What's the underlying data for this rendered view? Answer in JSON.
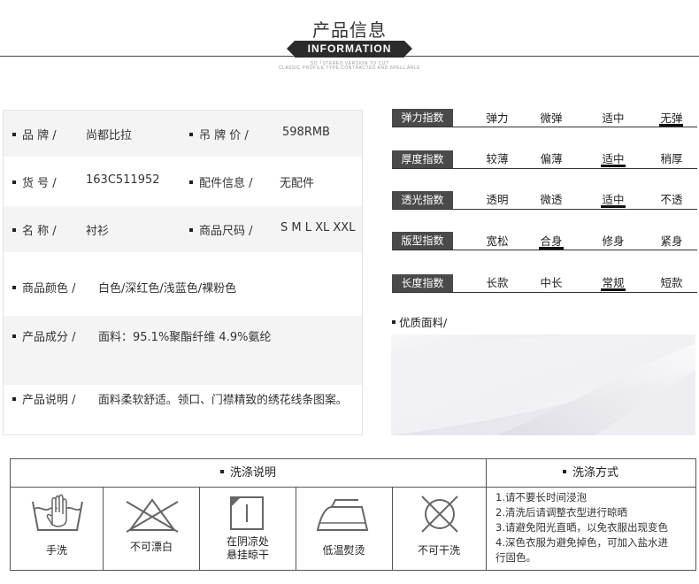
{
  "header": {
    "title_cn": "产品信息",
    "title_en": "INFORMATION",
    "tagline_1": "SO「STEREO VERSION TO CUT",
    "tagline_2": "CLASSIC PROFILE TYPE CONTRACTED AND SPELL ARLE"
  },
  "product": {
    "brand_label": "品  牌 /",
    "brand_value": "尚都比拉",
    "price_label": "吊 牌 价 /",
    "price_value": "598RMB",
    "sku_label": "货  号 /",
    "sku_value": "163C511952",
    "accessory_label": "配件信息 /",
    "accessory_value": "无配件",
    "name_label": "名  称 /",
    "name_value": "衬衫",
    "size_label": "商品尺码 /",
    "size_value": "S M L XL XXL",
    "color_label": "商品颜色 /",
    "color_value": "白色/深红色/浅蓝色/裸粉色",
    "material_label": "产品成分 /",
    "material_value": "面料：95.1%聚酯纤维 4.9%氨纶",
    "desc_label": "产品说明 /",
    "desc_value": "面料柔软舒适。领口、门襟精致的绣花线条图案。"
  },
  "indices": [
    {
      "label": "弹力指数",
      "options": [
        "弹力",
        "微弹",
        "适中",
        "无弹"
      ],
      "selected": 3
    },
    {
      "label": "厚度指数",
      "options": [
        "较薄",
        "偏薄",
        "适中",
        "稍厚"
      ],
      "selected": 2
    },
    {
      "label": "透光指数",
      "options": [
        "透明",
        "微透",
        "适中",
        "不透"
      ],
      "selected": 2
    },
    {
      "label": "版型指数",
      "options": [
        "宽松",
        "合身",
        "修身",
        "紧身"
      ],
      "selected": 1
    },
    {
      "label": "长度指数",
      "options": [
        "长款",
        "中长",
        "常规",
        "短款"
      ],
      "selected": 2
    }
  ],
  "fabric": {
    "title": "优质面料/"
  },
  "wash": {
    "instructions_title": "洗涤说明",
    "method_title": "洗涤方式",
    "icons": [
      {
        "name": "hand-wash-icon",
        "label": "手洗"
      },
      {
        "name": "no-bleach-icon",
        "label": "不可漂白"
      },
      {
        "name": "shade-dry-icon",
        "label_1": "在阴凉处",
        "label_2": "悬挂晾干"
      },
      {
        "name": "low-iron-icon",
        "label": "低温熨烫"
      },
      {
        "name": "no-dry-clean-icon",
        "label": "不可干洗"
      }
    ],
    "care": [
      "1.请不要长时间浸泡",
      "2.清洗后请调整衣型进行晾晒",
      "3.请避免阳光直晒，以免衣服出现变色",
      "4.深色衣服为避免掉色，可加入盐水进",
      "行固色。"
    ]
  },
  "colors": {
    "label_bg": "#4a4a4a",
    "band_bg": "#2b2b2b",
    "row_shade": "#f4f4f4"
  }
}
